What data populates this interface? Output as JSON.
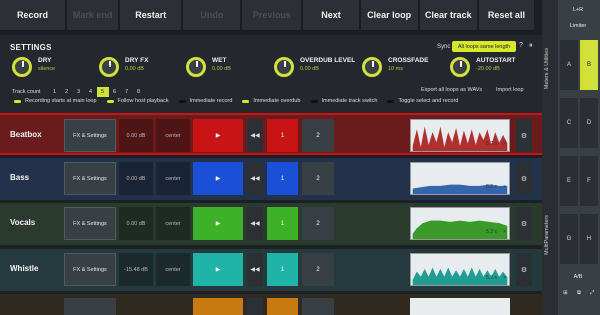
{
  "toolbar": {
    "buttons": [
      {
        "label": "Record",
        "enabled": true
      },
      {
        "label": "Mark end",
        "enabled": false
      },
      {
        "label": "Restart",
        "enabled": true
      },
      {
        "label": "Undo",
        "enabled": false
      },
      {
        "label": "Previous",
        "enabled": false
      },
      {
        "label": "Next",
        "enabled": true
      },
      {
        "label": "Clear loop",
        "enabled": true
      },
      {
        "label": "Clear track",
        "enabled": true
      },
      {
        "label": "Reset all",
        "enabled": true
      }
    ]
  },
  "settings": {
    "title": "SETTINGS",
    "sync_label": "Sync",
    "sync_value": "All loops same length",
    "help": "?",
    "pin": "⏸",
    "knobs": [
      {
        "name": "DRY",
        "value": "silence"
      },
      {
        "name": "DRY FX",
        "value": "0.00 dB"
      },
      {
        "name": "WET",
        "value": "0.00 dB"
      },
      {
        "name": "OVERDUB LEVEL",
        "value": "0.00 dB"
      },
      {
        "name": "CROSSFADE",
        "value": "10 ms"
      },
      {
        "name": "AUTOSTART",
        "value": "-20.00 dB"
      }
    ],
    "track_count_label": "Track count",
    "track_counts": [
      "1",
      "2",
      "3",
      "4",
      "5",
      "6",
      "7",
      "8"
    ],
    "track_count_selected": "5",
    "export_all": "Export all loops as WAVs",
    "import_loop": "Import loop",
    "options": [
      {
        "label": "Recording starts at main loop",
        "on": true
      },
      {
        "label": "Follow host playback",
        "on": true
      },
      {
        "label": "Immediate record",
        "on": false
      },
      {
        "label": "Immediate overdub",
        "on": true
      },
      {
        "label": "Immediate track switch",
        "on": false
      },
      {
        "label": "Toggle select and record",
        "on": false
      }
    ]
  },
  "tracks": [
    {
      "name": "Beatbox",
      "fx": "FX & Settings",
      "db": "0.00 dB",
      "pan": "center",
      "play": "▶",
      "prev": "◀◀",
      "loop": "1",
      "count": "2",
      "length": "5.2 s",
      "close": "×",
      "menu": "⚙",
      "color": "#c81414",
      "bg": "#6a1c1c"
    },
    {
      "name": "Bass",
      "fx": "FX & Settings",
      "db": "0.00 dB",
      "pan": "center",
      "play": "▶",
      "prev": "◀◀",
      "loop": "1",
      "count": "2",
      "length": "5.2 s",
      "close": "×",
      "menu": "⚙",
      "color": "#1b4fd6",
      "bg": "#22324a"
    },
    {
      "name": "Vocals",
      "fx": "FX & Settings",
      "db": "0.00 dB",
      "pan": "center",
      "play": "▶",
      "prev": "◀◀",
      "loop": "1",
      "count": "2",
      "length": "5.2 s",
      "close": "×",
      "menu": "⚙",
      "color": "#3fb02a",
      "bg": "#2a3a2e"
    },
    {
      "name": "Whistle",
      "fx": "FX & Settings",
      "db": "-15.48 dB",
      "pan": "center",
      "play": "▶",
      "prev": "◀◀",
      "loop": "1",
      "count": "2",
      "length": "5.2 s",
      "close": "×",
      "menu": "⚙",
      "color": "#1fb4a6",
      "bg": "#243a3c"
    }
  ],
  "side": {
    "tab1": "Meters & Utilities",
    "tab2": "MultiParameters",
    "lr": "L+R",
    "limiter": "Limiter",
    "cells": [
      "A",
      "B",
      "C",
      "D",
      "E",
      "F",
      "G",
      "H"
    ],
    "ab": "A/B"
  }
}
